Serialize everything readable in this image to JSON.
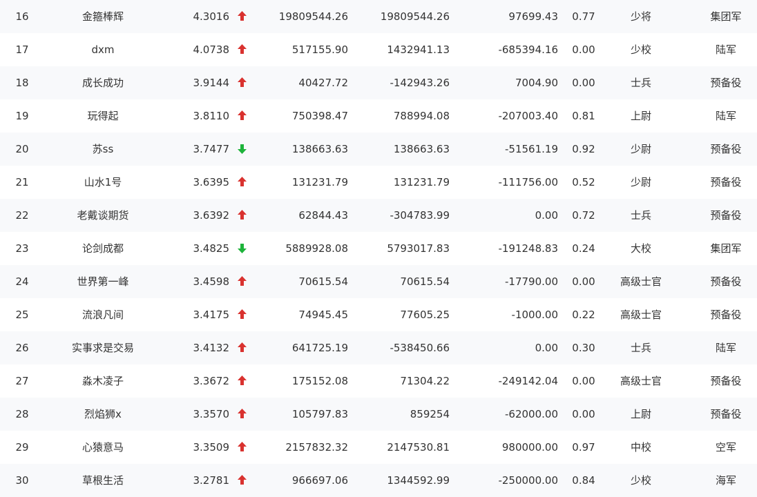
{
  "colors": {
    "up": "#d9322f",
    "down": "#1db33a"
  },
  "rows": [
    {
      "rank": "16",
      "name": "金箍棒辉",
      "score": "4.3016",
      "trend": "up",
      "v1": "19809544.26",
      "v2": "19809544.26",
      "v3": "97699.43",
      "v4": "0.77",
      "rank_title": "少将",
      "branch": "集团军"
    },
    {
      "rank": "17",
      "name": "dxm",
      "score": "4.0738",
      "trend": "up",
      "v1": "517155.90",
      "v2": "1432941.13",
      "v3": "-685394.16",
      "v4": "0.00",
      "rank_title": "少校",
      "branch": "陆军"
    },
    {
      "rank": "18",
      "name": "成长成功",
      "score": "3.9144",
      "trend": "up",
      "v1": "40427.72",
      "v2": "-142943.26",
      "v3": "7004.90",
      "v4": "0.00",
      "rank_title": "士兵",
      "branch": "预备役"
    },
    {
      "rank": "19",
      "name": "玩得起",
      "score": "3.8110",
      "trend": "up",
      "v1": "750398.47",
      "v2": "788994.08",
      "v3": "-207003.40",
      "v4": "0.81",
      "rank_title": "上尉",
      "branch": "陆军"
    },
    {
      "rank": "20",
      "name": "苏ss",
      "score": "3.7477",
      "trend": "down",
      "v1": "138663.63",
      "v2": "138663.63",
      "v3": "-51561.19",
      "v4": "0.92",
      "rank_title": "少尉",
      "branch": "预备役"
    },
    {
      "rank": "21",
      "name": "山水1号",
      "score": "3.6395",
      "trend": "up",
      "v1": "131231.79",
      "v2": "131231.79",
      "v3": "-111756.00",
      "v4": "0.52",
      "rank_title": "少尉",
      "branch": "预备役"
    },
    {
      "rank": "22",
      "name": "老戴谈期货",
      "score": "3.6392",
      "trend": "up",
      "v1": "62844.43",
      "v2": "-304783.99",
      "v3": "0.00",
      "v4": "0.72",
      "rank_title": "士兵",
      "branch": "预备役"
    },
    {
      "rank": "23",
      "name": "论剑成都",
      "score": "3.4825",
      "trend": "down",
      "v1": "5889928.08",
      "v2": "5793017.83",
      "v3": "-191248.83",
      "v4": "0.24",
      "rank_title": "大校",
      "branch": "集团军"
    },
    {
      "rank": "24",
      "name": "世界第一峰",
      "score": "3.4598",
      "trend": "up",
      "v1": "70615.54",
      "v2": "70615.54",
      "v3": "-17790.00",
      "v4": "0.00",
      "rank_title": "高级士官",
      "branch": "预备役"
    },
    {
      "rank": "25",
      "name": "流浪凡间",
      "score": "3.4175",
      "trend": "up",
      "v1": "74945.45",
      "v2": "77605.25",
      "v3": "-1000.00",
      "v4": "0.22",
      "rank_title": "高级士官",
      "branch": "预备役"
    },
    {
      "rank": "26",
      "name": "实事求是交易",
      "score": "3.4132",
      "trend": "up",
      "v1": "641725.19",
      "v2": "-538450.66",
      "v3": "0.00",
      "v4": "0.30",
      "rank_title": "士兵",
      "branch": "陆军"
    },
    {
      "rank": "27",
      "name": "淼木凌子",
      "score": "3.3672",
      "trend": "up",
      "v1": "175152.08",
      "v2": "71304.22",
      "v3": "-249142.04",
      "v4": "0.00",
      "rank_title": "高级士官",
      "branch": "预备役"
    },
    {
      "rank": "28",
      "name": "烈焰狮x",
      "score": "3.3570",
      "trend": "up",
      "v1": "105797.83",
      "v2": "859254",
      "v3": "-62000.00",
      "v4": "0.00",
      "rank_title": "上尉",
      "branch": "预备役"
    },
    {
      "rank": "29",
      "name": "心猿意马",
      "score": "3.3509",
      "trend": "up",
      "v1": "2157832.32",
      "v2": "2147530.81",
      "v3": "980000.00",
      "v4": "0.97",
      "rank_title": "中校",
      "branch": "空军"
    },
    {
      "rank": "30",
      "name": "草根生活",
      "score": "3.2781",
      "trend": "up",
      "v1": "966697.06",
      "v2": "1344592.99",
      "v3": "-250000.00",
      "v4": "0.84",
      "rank_title": "少校",
      "branch": "海军"
    }
  ]
}
